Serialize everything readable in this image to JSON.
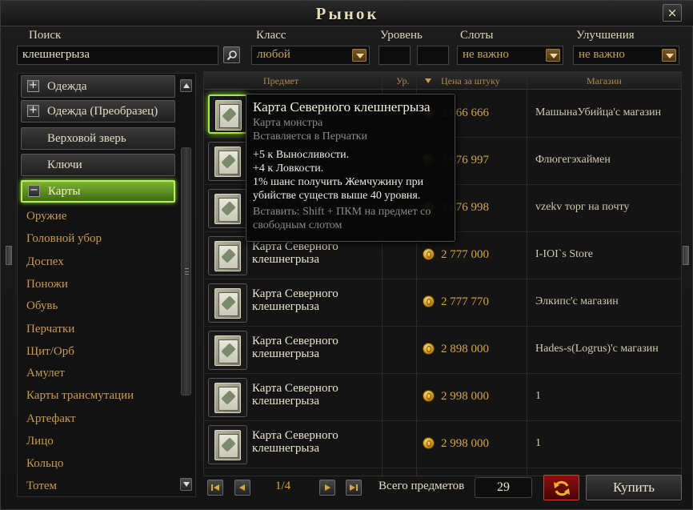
{
  "window": {
    "title": "Рынок",
    "close": "×"
  },
  "filters": {
    "search_label": "Поиск",
    "search_value": "клешнегрыза",
    "class_label": "Класс",
    "class_value": "любой",
    "level_label": "Уровень",
    "slots_label": "Слоты",
    "slots_value": "не важно",
    "upgrades_label": "Улучшения",
    "upgrades_value": "не важно"
  },
  "categories": {
    "buttons": [
      {
        "label": "Одежда",
        "toggle": "+"
      },
      {
        "label": "Одежда (Преобразец)",
        "toggle": "+"
      },
      {
        "label": "Верховой зверь",
        "toggle": ""
      },
      {
        "label": "Ключи",
        "toggle": ""
      },
      {
        "label": "Карты",
        "toggle": "−"
      }
    ],
    "sub_items": [
      "Оружие",
      "Головной убор",
      "Доспех",
      "Поножи",
      "Обувь",
      "Перчатки",
      "Щит/Орб",
      "Амулет",
      "Карты трансмутации",
      "Артефакт",
      "Лицо",
      "Кольцо",
      "Тотем"
    ]
  },
  "table": {
    "headers": {
      "item": "Предмет",
      "level": "Ур.",
      "price": "Цена за штуку",
      "shop": "Магазин"
    },
    "rows": [
      {
        "name": "Карта Северного клешнегрыза",
        "price": "2 666 666",
        "shop": "МашынаУбийца'с магазин"
      },
      {
        "name": "Карта Северного клешнегрыза",
        "price": "2 676 997",
        "shop": "Флюгегэхаймен"
      },
      {
        "name": "Карта Северного клешнегрыза",
        "price": "2 676 998",
        "shop": "vzekv торг на почту"
      },
      {
        "name": "Карта Северного клешнегрыза",
        "price": "2 777 000",
        "shop": "I-IOI`s Store"
      },
      {
        "name": "Карта Северного клешнегрыза",
        "price": "2 777 770",
        "shop": "Элкипс'с магазин"
      },
      {
        "name": "Карта Северного клешнегрыза",
        "price": "2 898 000",
        "shop": "Hades-s(Logrus)'с магазин"
      },
      {
        "name": "Карта Северного клешнегрыза",
        "price": "2 998 000",
        "shop": "1"
      },
      {
        "name": "Карта Северного клешнегрыза",
        "price": "2 998 000",
        "shop": "1"
      }
    ]
  },
  "tooltip": {
    "title": "Карта Северного клешнегрыза",
    "type": "Карта монстра",
    "slot": "Вставляется в Перчатки",
    "stat1": "+5 к Выносливости.",
    "stat2": "+4 к Ловкости.",
    "stat3": "1% шанс получить Жемчужину при убийстве существ выше 40 уровня.",
    "hint": "Вставить: Shift + ПКМ на предмет со свободным слотом"
  },
  "pagination": {
    "page": "1/4",
    "total_label": "Всего предметов",
    "total": "29"
  },
  "actions": {
    "buy": "Купить"
  },
  "colors": {
    "accent_green": "#8ee03a",
    "gold": "#d6a640",
    "refresh_red": "#8a1010"
  },
  "icons": [
    "close-icon",
    "search-icon",
    "chevron-down-icon",
    "coin-icon",
    "card-icon",
    "refresh-icon",
    "first-page-icon",
    "prev-page-icon",
    "next-page-icon",
    "last-page-icon"
  ]
}
